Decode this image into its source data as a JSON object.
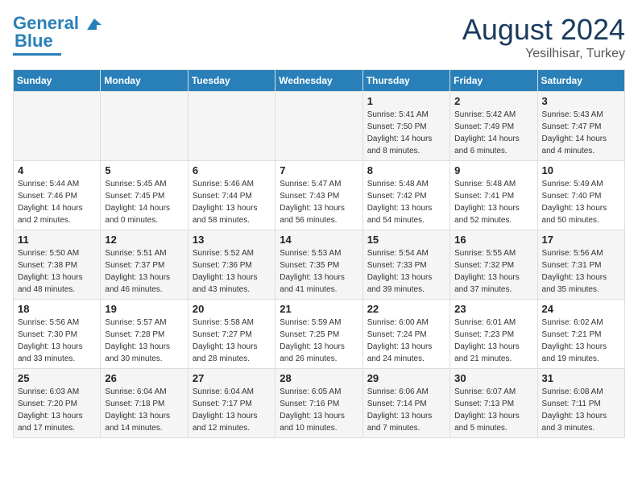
{
  "logo": {
    "text1": "General",
    "text2": "Blue"
  },
  "title": {
    "month": "August 2024",
    "location": "Yesilhisar, Turkey"
  },
  "headers": [
    "Sunday",
    "Monday",
    "Tuesday",
    "Wednesday",
    "Thursday",
    "Friday",
    "Saturday"
  ],
  "weeks": [
    [
      {
        "day": "",
        "info": ""
      },
      {
        "day": "",
        "info": ""
      },
      {
        "day": "",
        "info": ""
      },
      {
        "day": "",
        "info": ""
      },
      {
        "day": "1",
        "info": "Sunrise: 5:41 AM\nSunset: 7:50 PM\nDaylight: 14 hours\nand 8 minutes."
      },
      {
        "day": "2",
        "info": "Sunrise: 5:42 AM\nSunset: 7:49 PM\nDaylight: 14 hours\nand 6 minutes."
      },
      {
        "day": "3",
        "info": "Sunrise: 5:43 AM\nSunset: 7:47 PM\nDaylight: 14 hours\nand 4 minutes."
      }
    ],
    [
      {
        "day": "4",
        "info": "Sunrise: 5:44 AM\nSunset: 7:46 PM\nDaylight: 14 hours\nand 2 minutes."
      },
      {
        "day": "5",
        "info": "Sunrise: 5:45 AM\nSunset: 7:45 PM\nDaylight: 14 hours\nand 0 minutes."
      },
      {
        "day": "6",
        "info": "Sunrise: 5:46 AM\nSunset: 7:44 PM\nDaylight: 13 hours\nand 58 minutes."
      },
      {
        "day": "7",
        "info": "Sunrise: 5:47 AM\nSunset: 7:43 PM\nDaylight: 13 hours\nand 56 minutes."
      },
      {
        "day": "8",
        "info": "Sunrise: 5:48 AM\nSunset: 7:42 PM\nDaylight: 13 hours\nand 54 minutes."
      },
      {
        "day": "9",
        "info": "Sunrise: 5:48 AM\nSunset: 7:41 PM\nDaylight: 13 hours\nand 52 minutes."
      },
      {
        "day": "10",
        "info": "Sunrise: 5:49 AM\nSunset: 7:40 PM\nDaylight: 13 hours\nand 50 minutes."
      }
    ],
    [
      {
        "day": "11",
        "info": "Sunrise: 5:50 AM\nSunset: 7:38 PM\nDaylight: 13 hours\nand 48 minutes."
      },
      {
        "day": "12",
        "info": "Sunrise: 5:51 AM\nSunset: 7:37 PM\nDaylight: 13 hours\nand 46 minutes."
      },
      {
        "day": "13",
        "info": "Sunrise: 5:52 AM\nSunset: 7:36 PM\nDaylight: 13 hours\nand 43 minutes."
      },
      {
        "day": "14",
        "info": "Sunrise: 5:53 AM\nSunset: 7:35 PM\nDaylight: 13 hours\nand 41 minutes."
      },
      {
        "day": "15",
        "info": "Sunrise: 5:54 AM\nSunset: 7:33 PM\nDaylight: 13 hours\nand 39 minutes."
      },
      {
        "day": "16",
        "info": "Sunrise: 5:55 AM\nSunset: 7:32 PM\nDaylight: 13 hours\nand 37 minutes."
      },
      {
        "day": "17",
        "info": "Sunrise: 5:56 AM\nSunset: 7:31 PM\nDaylight: 13 hours\nand 35 minutes."
      }
    ],
    [
      {
        "day": "18",
        "info": "Sunrise: 5:56 AM\nSunset: 7:30 PM\nDaylight: 13 hours\nand 33 minutes."
      },
      {
        "day": "19",
        "info": "Sunrise: 5:57 AM\nSunset: 7:28 PM\nDaylight: 13 hours\nand 30 minutes."
      },
      {
        "day": "20",
        "info": "Sunrise: 5:58 AM\nSunset: 7:27 PM\nDaylight: 13 hours\nand 28 minutes."
      },
      {
        "day": "21",
        "info": "Sunrise: 5:59 AM\nSunset: 7:25 PM\nDaylight: 13 hours\nand 26 minutes."
      },
      {
        "day": "22",
        "info": "Sunrise: 6:00 AM\nSunset: 7:24 PM\nDaylight: 13 hours\nand 24 minutes."
      },
      {
        "day": "23",
        "info": "Sunrise: 6:01 AM\nSunset: 7:23 PM\nDaylight: 13 hours\nand 21 minutes."
      },
      {
        "day": "24",
        "info": "Sunrise: 6:02 AM\nSunset: 7:21 PM\nDaylight: 13 hours\nand 19 minutes."
      }
    ],
    [
      {
        "day": "25",
        "info": "Sunrise: 6:03 AM\nSunset: 7:20 PM\nDaylight: 13 hours\nand 17 minutes."
      },
      {
        "day": "26",
        "info": "Sunrise: 6:04 AM\nSunset: 7:18 PM\nDaylight: 13 hours\nand 14 minutes."
      },
      {
        "day": "27",
        "info": "Sunrise: 6:04 AM\nSunset: 7:17 PM\nDaylight: 13 hours\nand 12 minutes."
      },
      {
        "day": "28",
        "info": "Sunrise: 6:05 AM\nSunset: 7:16 PM\nDaylight: 13 hours\nand 10 minutes."
      },
      {
        "day": "29",
        "info": "Sunrise: 6:06 AM\nSunset: 7:14 PM\nDaylight: 13 hours\nand 7 minutes."
      },
      {
        "day": "30",
        "info": "Sunrise: 6:07 AM\nSunset: 7:13 PM\nDaylight: 13 hours\nand 5 minutes."
      },
      {
        "day": "31",
        "info": "Sunrise: 6:08 AM\nSunset: 7:11 PM\nDaylight: 13 hours\nand 3 minutes."
      }
    ]
  ]
}
